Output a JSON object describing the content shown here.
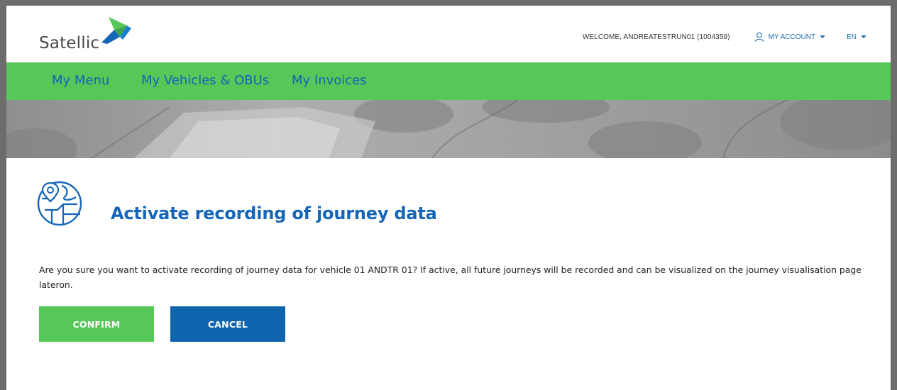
{
  "header": {
    "logo_text": "Satellic",
    "welcome": "WELCOME, ANDREATESTRUN01 (1004359)",
    "account_label": "MY ACCOUNT",
    "language": "EN"
  },
  "nav": {
    "items": [
      {
        "label": "My Menu"
      },
      {
        "label": "My Vehicles & OBUs"
      },
      {
        "label": "My Invoices"
      }
    ]
  },
  "page": {
    "title": "Activate recording of journey data",
    "message": "Are you sure you want to activate recording of journey data for vehicle 01 ANDTR 01? If active, all future journeys will be recorded and can be visualized on the journey visualisation page lateron.",
    "confirm_label": "CONFIRM",
    "cancel_label": "CANCEL"
  },
  "icons": {
    "logo": "satellic-arrow-logo",
    "account": "user-icon",
    "title": "journey-map-pin-icon"
  },
  "colors": {
    "brand_blue": "#1565b8",
    "nav_green": "#55c857",
    "confirm_green": "#55c857",
    "cancel_blue": "#0f65ad"
  }
}
